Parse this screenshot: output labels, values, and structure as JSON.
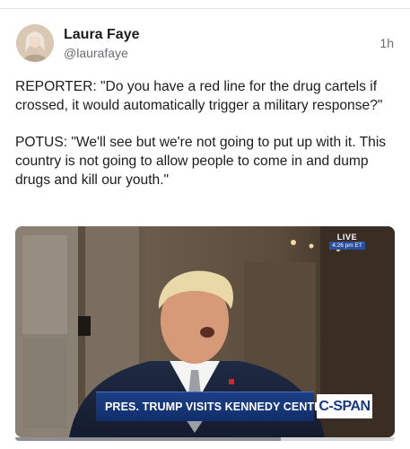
{
  "post": {
    "author": {
      "display_name": "Laura Faye",
      "handle": "@laurafaye",
      "avatar_icon": "profile-photo"
    },
    "timestamp": "1h",
    "paragraphs": [
      "REPORTER: \"Do you have a red line for the drug cartels if crossed, it would automatically trigger a military response?\"",
      "POTUS: \"We'll see but we're not going to put up with it. This country is not going to allow people to come in and dump drugs and kill our youth.\""
    ],
    "media": {
      "type": "video",
      "live_label": "LIVE",
      "live_time": "4:26 pm ET",
      "chyron_text": "PRES. TRUMP VISITS KENNEDY CENTER",
      "network_logo": "C-SPAN",
      "progress": 0.7
    }
  },
  "colors": {
    "chyron_blue": "#173a83",
    "text_primary": "#1c1c1e",
    "text_secondary": "#6b6b73"
  }
}
